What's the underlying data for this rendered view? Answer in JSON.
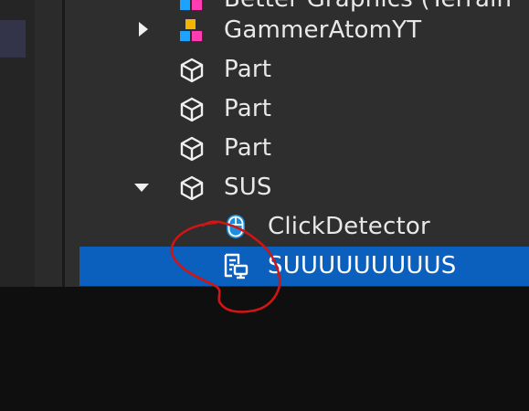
{
  "explorer": {
    "items": [
      {
        "label": "Better Graphics (Terrain",
        "icon": "model-icon",
        "indent": 0,
        "toggle": "none"
      },
      {
        "label": "GammerAtomYT",
        "icon": "model-icon",
        "indent": 0,
        "toggle": "collapsed"
      },
      {
        "label": "Part",
        "icon": "part-icon",
        "indent": 0,
        "toggle": "none"
      },
      {
        "label": "Part",
        "icon": "part-icon",
        "indent": 0,
        "toggle": "none"
      },
      {
        "label": "Part",
        "icon": "part-icon",
        "indent": 0,
        "toggle": "none"
      },
      {
        "label": "SUS",
        "icon": "part-icon",
        "indent": 0,
        "toggle": "expanded"
      },
      {
        "label": "ClickDetector",
        "icon": "click-detector-icon",
        "indent": 1,
        "toggle": "none"
      },
      {
        "label": "SUUUUUUUUUS",
        "icon": "script-icon",
        "indent": 1,
        "toggle": "none",
        "selected": true
      }
    ]
  },
  "colors": {
    "panel_bg": "#2e2e2e",
    "selection": "#0b5fbd",
    "text": "#e8e8e8",
    "annotation": "#d01515"
  }
}
